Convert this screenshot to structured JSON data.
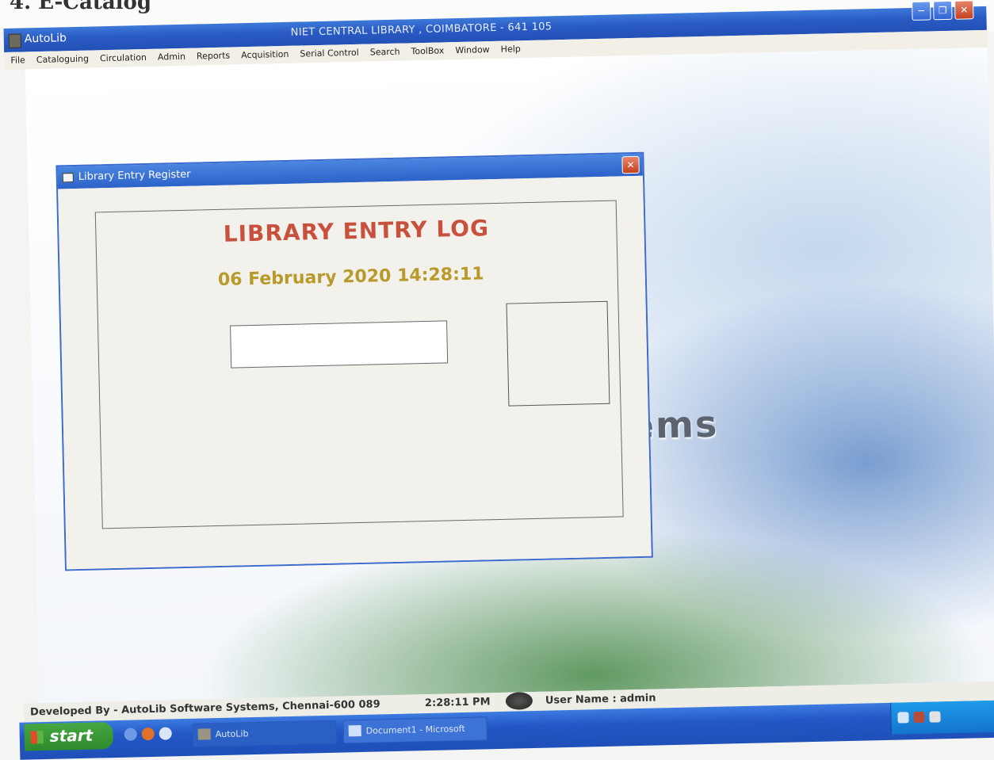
{
  "app": {
    "name": "AutoLib",
    "caption": "NIET CENTRAL LIBRARY , COIMBATORE - 641 105"
  },
  "menu": [
    "File",
    "Cataloguing",
    "Circulation",
    "Admin",
    "Reports",
    "Acquisition",
    "Serial Control",
    "Search",
    "ToolBox",
    "Window",
    "Help"
  ],
  "desktop": {
    "brand_text": "e Systems"
  },
  "dialog": {
    "title": "Library Entry Register",
    "heading": "LIBRARY ENTRY LOG",
    "datetime": "06 February 2020 14:28:11",
    "entry_value": "",
    "colors": {
      "heading": "#c8513e",
      "datetime": "#b79a2b"
    }
  },
  "status": {
    "developed_by": "Developed By -  AutoLib Software Systems, Chennai-600 089",
    "time": "2:28:11 PM",
    "user": "User Name : admin"
  },
  "taskbar": {
    "start_label": "start",
    "tasks": [
      "AutoLib",
      "Document1 - Microsoft"
    ],
    "tray_icons": [
      "network-icon",
      "security-icon",
      "volume-icon"
    ]
  }
}
